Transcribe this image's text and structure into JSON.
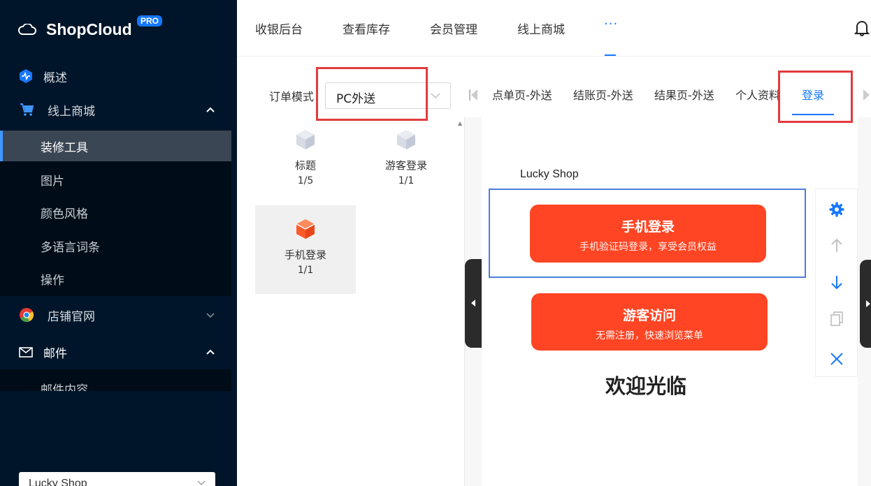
{
  "brand": {
    "name": "ShopCloud",
    "badge": "PRO"
  },
  "sidebar": {
    "overview": "概述",
    "online_mall": "线上商城",
    "mall_items": [
      "装修工具",
      "图片",
      "颜色风格",
      "多语言词条",
      "操作"
    ],
    "store_site": "店铺官网",
    "mail": "邮件",
    "mail_items": [
      "邮件内容"
    ],
    "shop_selector": "Lucky Shop"
  },
  "topnav": {
    "items": [
      "收银后台",
      "查看库存",
      "会员管理",
      "线上商城"
    ],
    "more": "···"
  },
  "order_mode": {
    "label": "订单模式",
    "value": "PC外送"
  },
  "components": [
    {
      "title": "标题",
      "count": "1/5"
    },
    {
      "title": "游客登录",
      "count": "1/1"
    },
    {
      "title": "手机登录",
      "count": "1/1"
    }
  ],
  "page_tabs": [
    "点单页-外送",
    "结账页-外送",
    "结果页-外送",
    "个人资料",
    "登录"
  ],
  "preview": {
    "shop_name": "Lucky Shop",
    "phone_login": {
      "title": "手机登录",
      "subtitle": "手机验证码登录，享受会员权益"
    },
    "guest_visit": {
      "title": "游客访问",
      "subtitle": "无需注册，快速浏览菜单"
    },
    "welcome": "欢迎光临"
  },
  "colors": {
    "sidebar": "#001529",
    "accent": "#1677ff",
    "button": "#ff4523",
    "highlight": "#e23b3b"
  }
}
